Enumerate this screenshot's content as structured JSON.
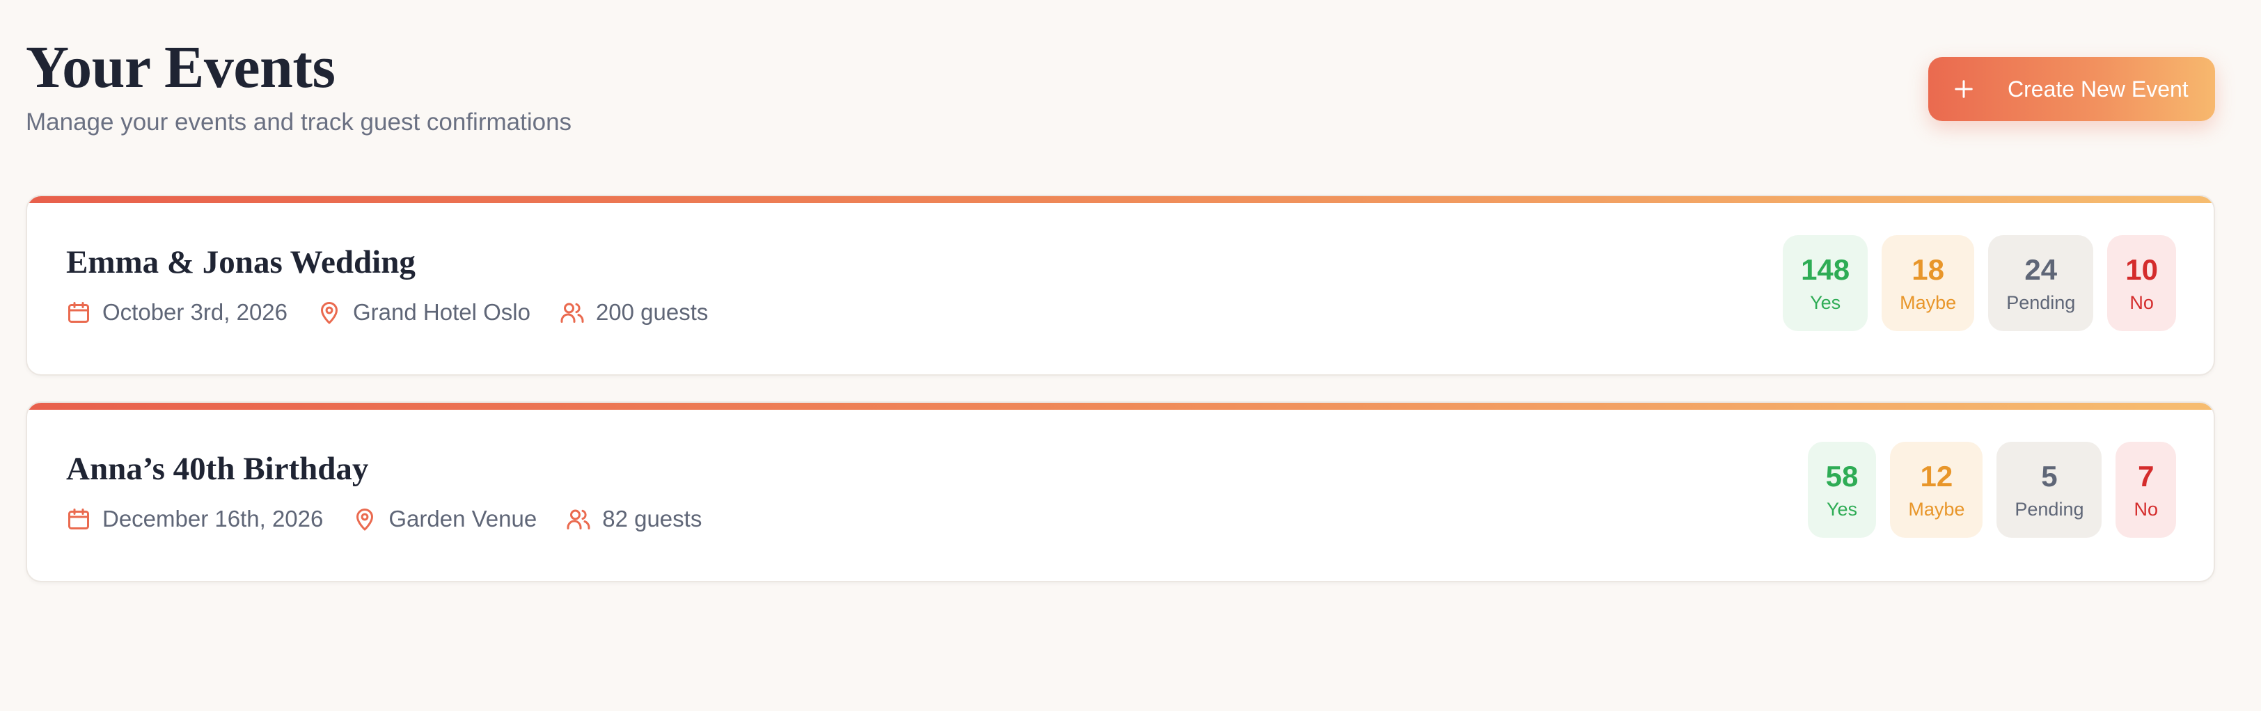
{
  "header": {
    "title": "Your Events",
    "subtitle": "Manage your events and track guest confirmations",
    "create_button_label": "Create New Event"
  },
  "icons": {
    "create": "plus-icon",
    "date": "calendar-icon",
    "location": "map-pin-icon",
    "guests": "users-icon"
  },
  "colors": {
    "accent": "#ea6a4f",
    "accent_end": "#f7b86e",
    "yes": "#2eac55",
    "maybe": "#e8962a",
    "pending": "#5f6677",
    "no": "#d42c2c"
  },
  "events": [
    {
      "title": "Emma & Jonas Wedding",
      "date": "October 3rd, 2026",
      "location": "Grand Hotel Oslo",
      "guests": "200 guests",
      "stats": {
        "yes": {
          "value": "148",
          "label": "Yes"
        },
        "maybe": {
          "value": "18",
          "label": "Maybe"
        },
        "pending": {
          "value": "24",
          "label": "Pending"
        },
        "no": {
          "value": "10",
          "label": "No"
        }
      }
    },
    {
      "title": "Anna’s 40th Birthday",
      "date": "December 16th, 2026",
      "location": "Garden Venue",
      "guests": "82 guests",
      "stats": {
        "yes": {
          "value": "58",
          "label": "Yes"
        },
        "maybe": {
          "value": "12",
          "label": "Maybe"
        },
        "pending": {
          "value": "5",
          "label": "Pending"
        },
        "no": {
          "value": "7",
          "label": "No"
        }
      }
    }
  ]
}
